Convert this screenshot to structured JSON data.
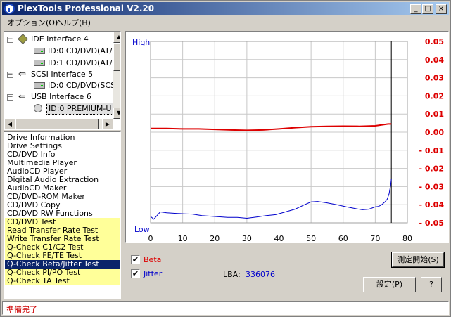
{
  "window": {
    "title": "PlexTools Professional V2.20",
    "controls": [
      "_",
      "□",
      "×"
    ]
  },
  "menu": [
    "オプション(O)",
    "ヘルプ(H)"
  ],
  "tree": [
    {
      "label": "IDE Interface 4",
      "type": "interface",
      "expanded": true
    },
    {
      "label": "ID:0  CD/DVD(AT/",
      "type": "drive"
    },
    {
      "label": "ID:1  CD/DVD(AT/",
      "type": "drive"
    },
    {
      "label": "SCSI Interface 5",
      "type": "interface",
      "expanded": true
    },
    {
      "label": "ID:0  CD/DVD(SCS",
      "type": "drive"
    },
    {
      "label": "USB Interface 6",
      "type": "interface",
      "expanded": true
    },
    {
      "label": "ID:0  PREMIUM-U",
      "type": "drive",
      "selected": true
    }
  ],
  "functions": [
    {
      "label": "Drive Information",
      "group": "normal"
    },
    {
      "label": "Drive Settings",
      "group": "normal"
    },
    {
      "label": "CD/DVD Info",
      "group": "normal"
    },
    {
      "label": "Multimedia Player",
      "group": "normal"
    },
    {
      "label": "AudioCD Player",
      "group": "normal"
    },
    {
      "label": "Digital Audio Extraction",
      "group": "normal"
    },
    {
      "label": "AudioCD Maker",
      "group": "normal"
    },
    {
      "label": "CD/DVD-ROM Maker",
      "group": "normal"
    },
    {
      "label": "CD/DVD Copy",
      "group": "normal"
    },
    {
      "label": "CD/DVD RW Functions",
      "group": "normal"
    },
    {
      "label": "CD/DVD Test",
      "group": "test"
    },
    {
      "label": "Read Transfer Rate Test",
      "group": "test"
    },
    {
      "label": "Write Transfer Rate Test",
      "group": "test"
    },
    {
      "label": "Q-Check C1/C2 Test",
      "group": "test"
    },
    {
      "label": "Q-Check FE/TE Test",
      "group": "test"
    },
    {
      "label": "Q-Check Beta/Jitter Test",
      "group": "test",
      "selected": true
    },
    {
      "label": "Q-Check PI/PO Test",
      "group": "test"
    },
    {
      "label": "Q-Check TA Test",
      "group": "test"
    }
  ],
  "controls": {
    "beta_label": "Beta",
    "jitter_label": "Jitter",
    "beta_checked": "✔",
    "jitter_checked": "✔",
    "lba_label": "LBA:",
    "lba_value": "336076",
    "start_button": "測定開始(S)",
    "settings_button": "設定(P)",
    "help_button": "?"
  },
  "status": "準備完了",
  "colors": {
    "beta": "#dd0000",
    "jitter": "#0000cc",
    "selection": "#0a246a",
    "test_highlight": "#ffff99"
  },
  "chart_data": {
    "type": "line",
    "title": "",
    "xlabel": "",
    "ylabel": "",
    "left_axis_labels": {
      "top": "High",
      "bottom": "Low"
    },
    "xlim": [
      0,
      80
    ],
    "x_ticks": [
      0,
      10,
      20,
      30,
      40,
      50,
      60,
      70,
      80
    ],
    "ylim": [
      -0.05,
      0.05
    ],
    "y_ticks": [
      0.05,
      0.04,
      0.03,
      0.02,
      0.01,
      0.0,
      -0.01,
      -0.02,
      -0.03,
      -0.04,
      -0.05
    ],
    "y_tick_labels": [
      "0.05",
      "0.04",
      "0.03",
      "0.02",
      "0.01",
      "0.00",
      "- 0.01",
      "- 0.02",
      "- 0.03",
      "- 0.04",
      "- 0.05"
    ],
    "grid": true,
    "cursor_x": 75,
    "series": [
      {
        "name": "Beta",
        "axis": "right",
        "x": [
          0,
          5,
          10,
          15,
          20,
          25,
          30,
          35,
          40,
          45,
          50,
          55,
          60,
          65,
          70,
          74,
          75
        ],
        "values": [
          0.002,
          0.002,
          0.0018,
          0.0018,
          0.0015,
          0.0012,
          0.001,
          0.0012,
          0.0018,
          0.0025,
          0.003,
          0.0032,
          0.0033,
          0.0032,
          0.0035,
          0.0045,
          0.0045
        ]
      },
      {
        "name": "Jitter",
        "axis": "right",
        "x": [
          0,
          1,
          3,
          5,
          8,
          10,
          13,
          16,
          20,
          24,
          27,
          30,
          33,
          36,
          39,
          42,
          45,
          48,
          50,
          52,
          55,
          58,
          61,
          64,
          66,
          68,
          70,
          71,
          72,
          73,
          73.7,
          74.3,
          74.8,
          75
        ],
        "values": [
          -0.0465,
          -0.048,
          -0.044,
          -0.0445,
          -0.0448,
          -0.045,
          -0.0452,
          -0.046,
          -0.0465,
          -0.047,
          -0.047,
          -0.0475,
          -0.0468,
          -0.046,
          -0.0455,
          -0.044,
          -0.0425,
          -0.04,
          -0.0385,
          -0.0382,
          -0.039,
          -0.04,
          -0.0412,
          -0.0422,
          -0.0428,
          -0.0425,
          -0.0412,
          -0.041,
          -0.04,
          -0.0385,
          -0.037,
          -0.034,
          -0.029,
          -0.026
        ]
      }
    ]
  }
}
